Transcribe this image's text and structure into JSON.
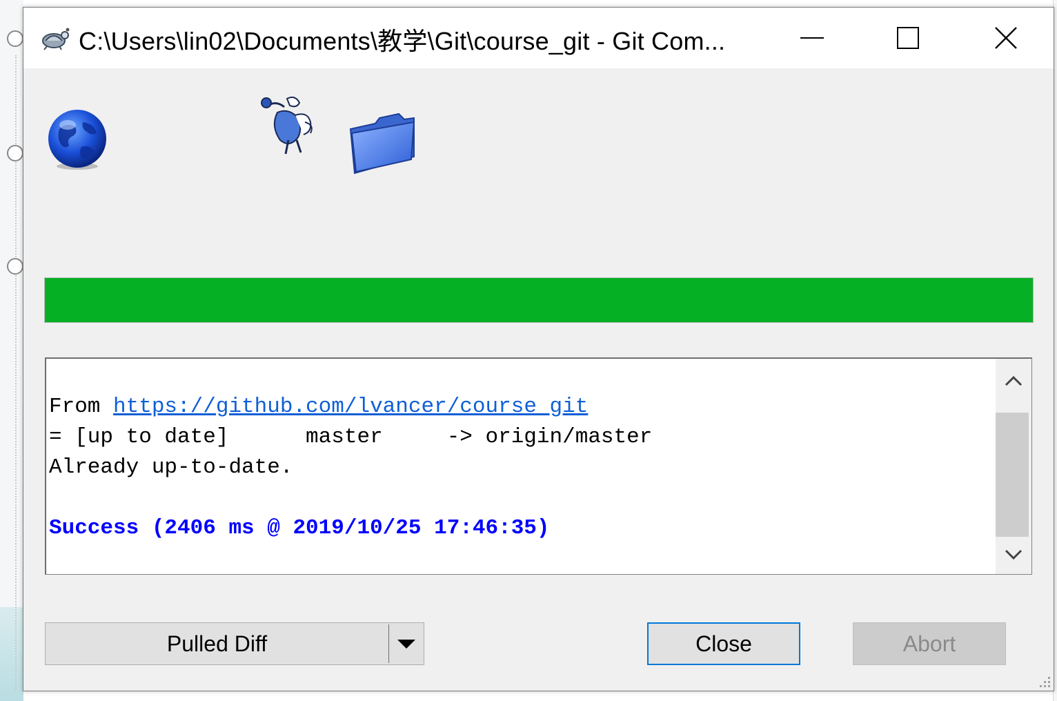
{
  "window": {
    "title": "C:\\Users\\lin02\\Documents\\教学\\Git\\course_git - Git Com..."
  },
  "progress": {
    "percent": 100,
    "color": "#06b025"
  },
  "log": {
    "line1_prefix": "From ",
    "line1_link": "https://github.com/lvancer/course_git",
    "line2": "= [up to date]      master     -> origin/master",
    "line3": "Already up-to-date.",
    "success": "Success (2406 ms @ 2019/10/25 17:46:35)"
  },
  "buttons": {
    "pulled_diff": "Pulled Diff",
    "close": "Close",
    "abort": "Abort"
  },
  "icons": {
    "app": "tortoisegit-icon",
    "globe": "globe-icon",
    "tortoise": "tortoise-animation-icon",
    "folder": "folder-icon"
  },
  "colors": {
    "accent": "#0078d7",
    "success_text": "#0000ff",
    "link": "#0f5fd6"
  }
}
